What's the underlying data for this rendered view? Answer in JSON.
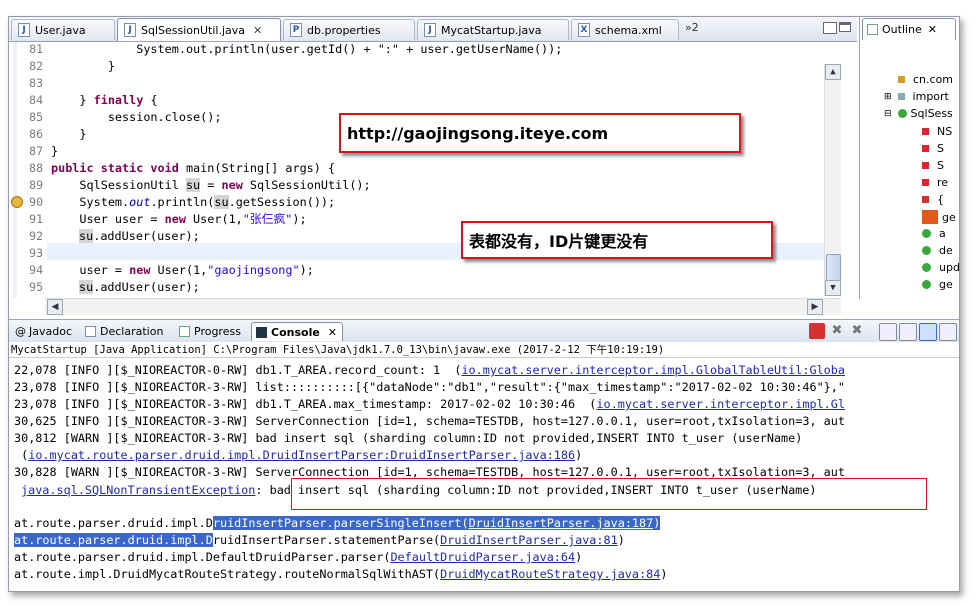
{
  "editor_tabs": [
    {
      "label": "User.java",
      "icon": "J",
      "active": false
    },
    {
      "label": "SqlSessionUtil.java",
      "icon": "J",
      "active": true
    },
    {
      "label": "db.properties",
      "icon": "P",
      "active": false
    },
    {
      "label": "MycatStartup.java",
      "icon": "J",
      "active": false
    },
    {
      "label": "schema.xml",
      "icon": "X",
      "active": false
    }
  ],
  "tab_overflow": "»2",
  "outline": {
    "tab_label": "Outline",
    "items": [
      "cn.com",
      "import",
      "SqlSess",
      "NS",
      "S",
      "S",
      "re",
      "{",
      "ge",
      "a",
      "de",
      "upd",
      "ge"
    ]
  },
  "code": {
    "line_numbers": [
      "81",
      "82",
      "83",
      "84",
      "85",
      "86",
      "87",
      "88",
      "89",
      "90",
      "91",
      "92",
      "93",
      "94",
      "95"
    ],
    "l81": "            System.out.println(user.getId() + \":\" + user.getUserName());",
    "l82": "        }",
    "l83": "",
    "l84_a": "    } ",
    "l84_kw": "finally",
    "l84_b": " {",
    "l85": "        session.close();",
    "l86": "    }",
    "l87": "}",
    "l88_kw": "public static void",
    "l88_b": " main(String[] args) {",
    "l89_a": "    SqlSessionUtil ",
    "l89_hl": "su",
    "l89_b": " = ",
    "l89_kw": "new",
    "l89_c": " SqlSessionUtil();",
    "l90_a": "    System.",
    "l90_fld": "out",
    "l90_b": ".println(",
    "l90_hl": "su",
    "l90_c": ".getSession());",
    "l91_a": "    User user = ",
    "l91_kw": "new",
    "l91_b": " User(1,",
    "l91_str": "\"张仨疯\"",
    "l91_c": ");",
    "l92_hl": "su",
    "l92_b": ".addUser(user);",
    "l93": "",
    "l94_a": "    user = ",
    "l94_kw": "new",
    "l94_b": " User(1,",
    "l94_str": "\"gaojingsong\"",
    "l94_c": ");",
    "l95_hl": "su",
    "l95_b": ".addUser(user);"
  },
  "callouts": {
    "url": "http://gaojingsong.iteye.com",
    "note": "表都没有，ID片键更没有"
  },
  "panel_tabs": [
    "Javadoc",
    "Declaration",
    "Progress",
    "Console"
  ],
  "console": {
    "title": "MycatStartup [Java Application] C:\\Program Files\\Java\\jdk1.7.0_13\\bin\\javaw.exe (2017-2-12 下午10:19:19)",
    "l1_a": "22,078 [INFO ][$_NIOREACTOR-0-RW] db1.T_AREA.record_count: 1  (",
    "l1_link": "io.mycat.server.interceptor.impl.GlobalTableUtil:Globa",
    "l2_a": "23,078 [INFO ][$_NIOREACTOR-3-RW] list::::::::::[{\"dataNode\":\"db1\",\"result\":{\"max_timestamp\":\"2017-02-02 10:30:46\"},\"",
    "l3_a": "23,078 [INFO ][$_NIOREACTOR-3-RW] db1.T_AREA.max_timestamp: 2017-02-02 10:30:46  (",
    "l3_link": "io.mycat.server.interceptor.impl.Gl",
    "l4_a": "30,625 [INFO ][$_NIOREACTOR-3-RW] ServerConnection [id=1, schema=TESTDB, host=127.0.0.1, user=root,txIsolation=3, aut",
    "l5_a": "30,812 [WARN ][$_NIOREACTOR-3-RW] bad insert sql (sharding column:ID not provided,INSERT INTO t_user (userName)",
    "l6_a": " (",
    "l6_link": "io.mycat.route.parser.druid.impl.DruidInsertParser:DruidInsertParser.java:186",
    "l6_b": ")",
    "l7_a": "30,828 [WARN ][$_NIOREACTOR-3-RW] ServerConnection [id=1, schema=TESTDB, host=127.0.0.1, user=root,txIsolation=3, aut",
    "l8_link": "java.sql.SQLNonTransientException",
    "l8_b": ": bad insert sql (sharding column:ID not provided,INSERT INTO t_user (userName)",
    "l10_a": "at.route.parser.druid.impl.D",
    "l10_sel": "ruidInsertParser.parserSingleInsert(",
    "l10_sel_link": "DruidInsertParser.java:187",
    "l10_sel_b": ")",
    "l11_sel": "at.route.parser.druid.impl.D",
    "l11_b": "ruidInsertParser.statementParse(",
    "l11_link": "DruidInsertParser.java:81",
    "l11_c": ")",
    "l12_a": "at.route.parser.druid.impl.DefaultDruidParser.parser(",
    "l12_link": "DefaultDruidParser.java:64",
    "l12_b": ")",
    "l13_a": "at.route.impl.DruidMycatRouteStrategy.routeNormalSqlWithAST(",
    "l13_link": "DruidMycatRouteStrategy.java:84",
    "l13_b": ")"
  }
}
